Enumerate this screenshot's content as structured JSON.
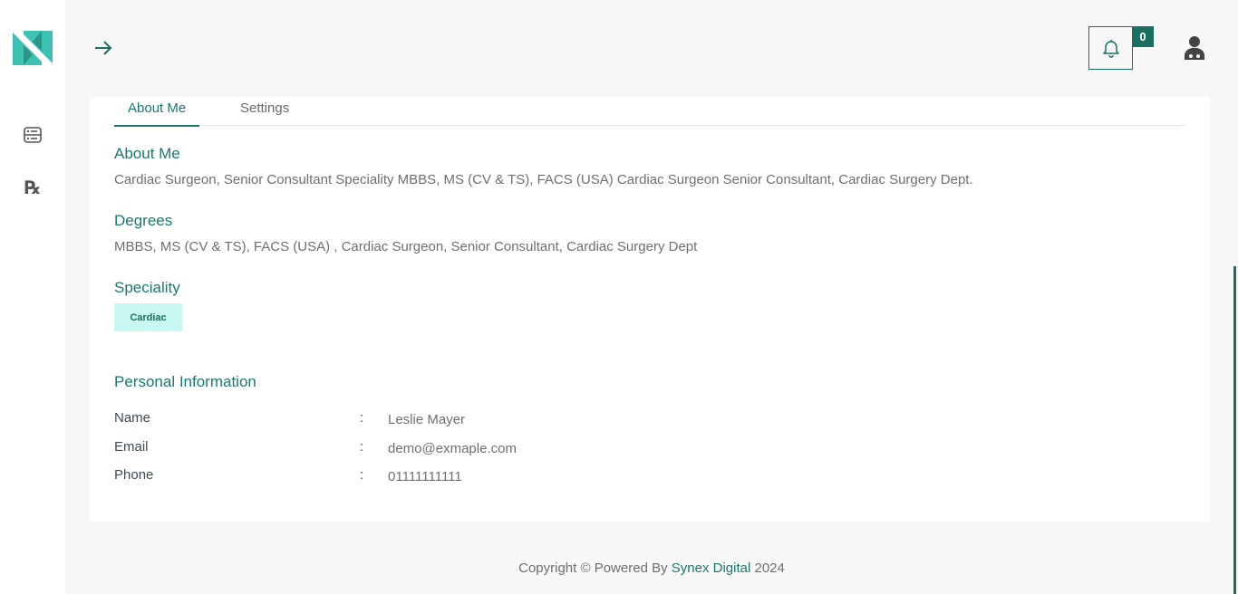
{
  "header": {
    "notification_count": "0"
  },
  "icons": {
    "logo": "logo-icon",
    "dashboard": "dashboard-icon",
    "prescription": "prescription-icon",
    "prescription_glyph": "℞",
    "toggle": "arrow-right-icon",
    "bell": "bell-icon",
    "user": "doctor-user-icon"
  },
  "colors": {
    "accent": "#1b7a6d",
    "badge_bg": "#c9f7f1",
    "page_bg": "#f7f7f7"
  },
  "tabs": [
    {
      "label": "About Me",
      "active": true
    },
    {
      "label": "Settings",
      "active": false
    }
  ],
  "about": {
    "title": "About Me",
    "text": "Cardiac Surgeon, Senior Consultant Speciality MBBS, MS (CV & TS), FACS (USA) Cardiac Surgeon Senior Consultant, Cardiac Surgery Dept."
  },
  "degrees": {
    "title": "Degrees",
    "text": "MBBS, MS (CV & TS), FACS (USA) , Cardiac Surgeon, Senior Consultant, Cardiac Surgery Dept"
  },
  "speciality": {
    "title": "Speciality",
    "badge": "Cardiac"
  },
  "personal": {
    "title": "Personal Information",
    "separator": ":",
    "rows": [
      {
        "label": "Name",
        "value": "Leslie Mayer"
      },
      {
        "label": "Email",
        "value": "demo@exmaple.com"
      },
      {
        "label": "Phone",
        "value": "01111111111"
      }
    ]
  },
  "footer": {
    "prefix": "Copyright © Powered By",
    "brand": "Synex Digital",
    "year": "2024"
  }
}
